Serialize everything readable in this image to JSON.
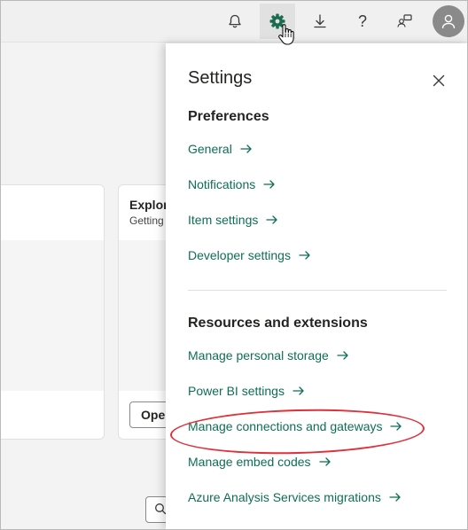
{
  "topbar": {
    "icons": [
      "bell-icon",
      "gear-icon",
      "download-icon",
      "help-icon",
      "share-icon",
      "avatar-icon"
    ],
    "help_glyph": "?"
  },
  "workspace": {
    "card_right": {
      "title": "Explor",
      "subtitle": "Getting",
      "open_label": "Oper"
    }
  },
  "settings": {
    "title": "Settings",
    "preferences": {
      "heading": "Preferences",
      "links": [
        "General",
        "Notifications",
        "Item settings",
        "Developer settings"
      ]
    },
    "resources": {
      "heading": "Resources and extensions",
      "links": [
        "Manage personal storage",
        "Power BI settings",
        "Manage connections and gateways",
        "Manage embed codes",
        "Azure Analysis Services migrations"
      ]
    }
  },
  "colors": {
    "link": "#0e6e55",
    "accent_gear": "#1a6b4f",
    "highlight": "#e0303a"
  }
}
